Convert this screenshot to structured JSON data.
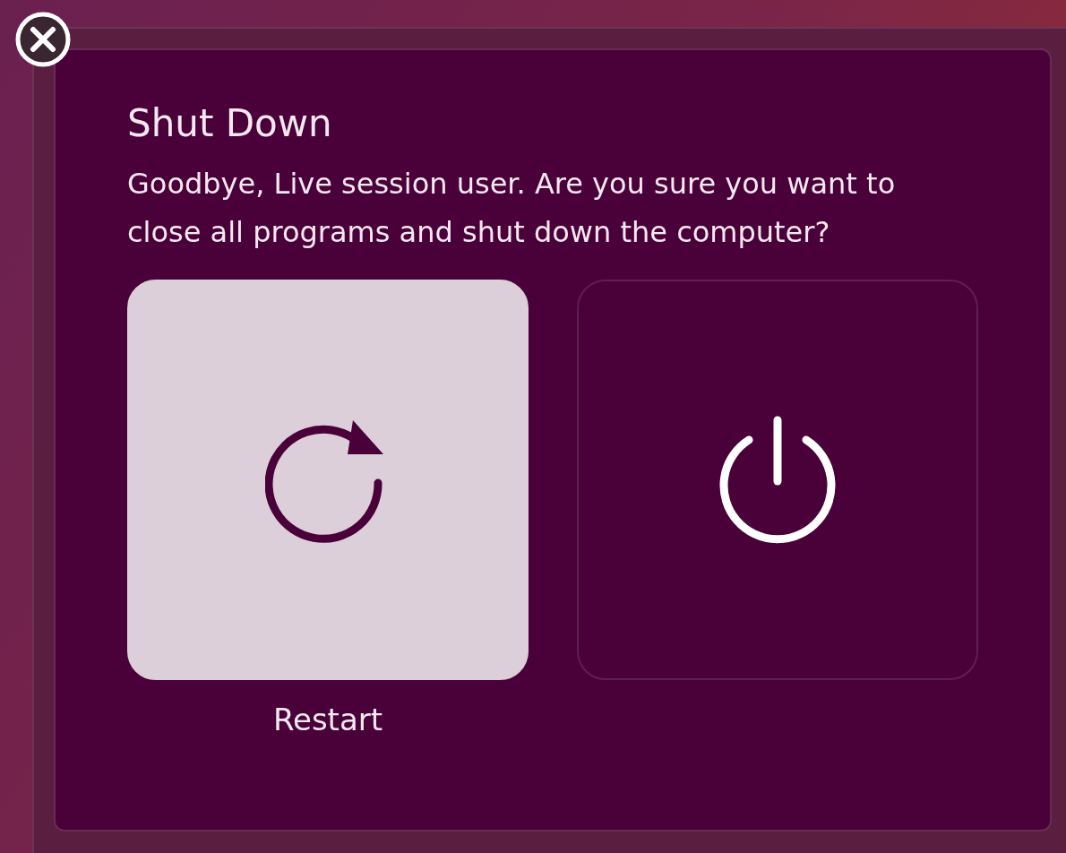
{
  "dialog": {
    "title": "Shut Down",
    "message": "Goodbye, Live session user. Are you sure you want to close all programs and shut down the computer?"
  },
  "actions": [
    {
      "kind": "restart",
      "label": "Restart",
      "selected": true
    },
    {
      "kind": "shutdown",
      "selected": false
    }
  ]
}
